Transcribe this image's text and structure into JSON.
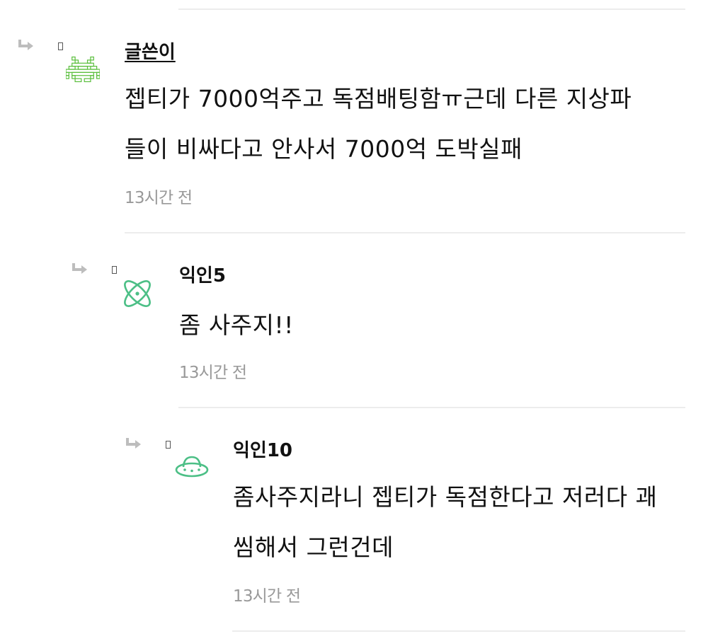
{
  "comments": [
    {
      "author": "글쓴이",
      "avatar_icon": "space-invader-icon",
      "avatar_color": "#5bbf3e",
      "text_lines": [
        "젭티가 7000억주고 독점배팅함ㅠ근데 다른 지상파",
        "들이 비싸다고 안사서 7000억 도박실패"
      ],
      "time": "13시간 전"
    },
    {
      "author": "익인5",
      "avatar_icon": "atom-icon",
      "avatar_color": "#4cbf86",
      "text_lines": [
        "좀 사주지!!"
      ],
      "time": "13시간 전"
    },
    {
      "author": "익인10",
      "avatar_icon": "ufo-icon",
      "avatar_color": "#4cbf86",
      "text_lines": [
        "좀사주지라니 젭티가 독점한다고 저러다 괘",
        "씸해서 그런건데"
      ],
      "time": "13시간 전"
    }
  ]
}
